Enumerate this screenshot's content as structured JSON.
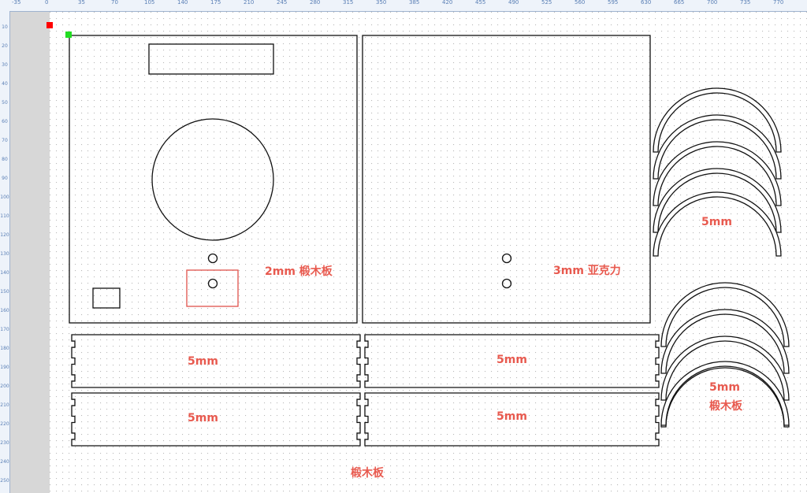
{
  "ruler_top": {
    "ticks": [
      "-35",
      "0",
      "35",
      "70",
      "105",
      "140",
      "175",
      "210",
      "245",
      "280",
      "315",
      "350",
      "385",
      "420",
      "455",
      "490",
      "525",
      "560",
      "595",
      "630",
      "665",
      "700",
      "735",
      "770"
    ]
  },
  "ruler_left": {
    "ticks": [
      "10",
      "20",
      "30",
      "40",
      "50",
      "60",
      "70",
      "80",
      "90",
      "100",
      "110",
      "120",
      "130",
      "140",
      "150",
      "160",
      "170",
      "180",
      "190",
      "200",
      "210",
      "220",
      "230",
      "240",
      "250"
    ]
  },
  "labels": {
    "panel_a_material": "2mm 椴木板",
    "panel_b_material": "3mm 亚克力",
    "strip_1": "5mm",
    "strip_2": "5mm",
    "strip_3": "5mm",
    "strip_4": "5mm",
    "arcs_top": "5mm",
    "arcs_bottom_thickness": "5mm",
    "arcs_bottom_material": "椴木板",
    "bottom_material": "椴木板"
  },
  "colors": {
    "label": "#e85a4f",
    "outline": "#111111",
    "selection": "#e0524a",
    "grid_dot": "#b9b9b9",
    "ruler_text": "#5a7fb5",
    "gutter": "#d7d7d7"
  }
}
